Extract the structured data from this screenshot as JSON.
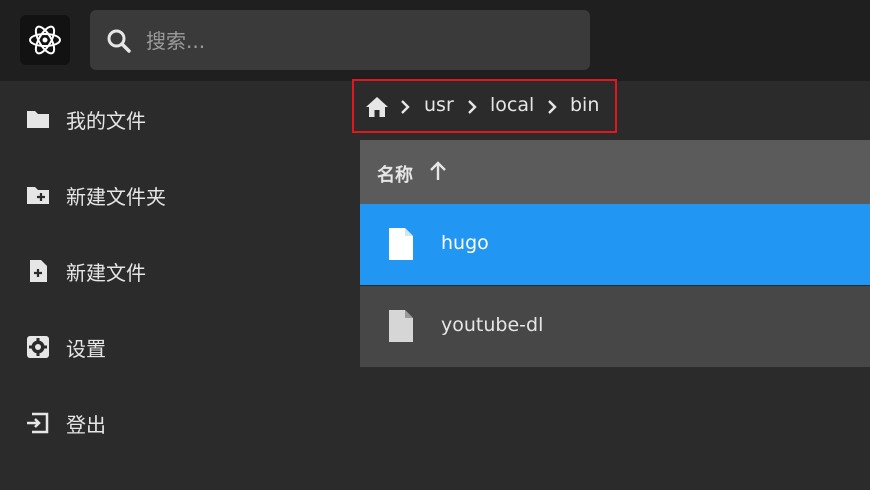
{
  "header": {
    "logo_icon": "atom-logo-icon",
    "search": {
      "placeholder": "搜索...",
      "icon": "search-icon"
    }
  },
  "sidebar": {
    "items": [
      {
        "label": "我的文件",
        "icon": "folder-icon"
      },
      {
        "label": "新建文件夹",
        "icon": "new-folder-icon"
      },
      {
        "label": "新建文件",
        "icon": "new-file-icon"
      },
      {
        "label": "设置",
        "icon": "settings-icon"
      },
      {
        "label": "登出",
        "icon": "logout-icon"
      }
    ]
  },
  "breadcrumb": {
    "home_icon": "home-icon",
    "items": [
      "usr",
      "local",
      "bin"
    ],
    "highlight_color": "#e0171f"
  },
  "file_list": {
    "column_name": "名称",
    "sort_icon": "arrow-up-icon",
    "files": [
      {
        "name": "hugo",
        "selected": true
      },
      {
        "name": "youtube-dl",
        "selected": false
      }
    ],
    "selected_color": "#2196f3"
  }
}
